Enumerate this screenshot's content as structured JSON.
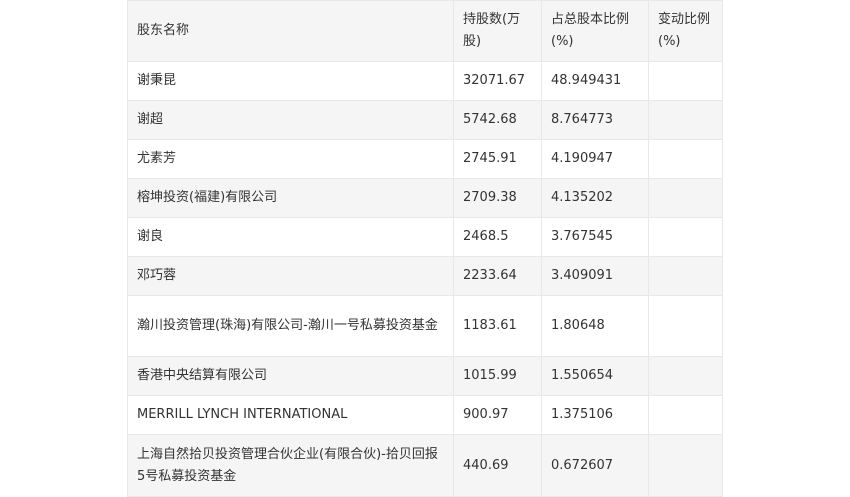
{
  "table": {
    "headers": [
      "股东名称",
      "持股数(万股)",
      "占总股本比例(%)",
      "变动比例(%)"
    ],
    "rows": [
      {
        "name": "谢秉昆",
        "shares": "32071.67",
        "ratio": "48.949431",
        "change": ""
      },
      {
        "name": "谢超",
        "shares": "5742.68",
        "ratio": "8.764773",
        "change": ""
      },
      {
        "name": "尤素芳",
        "shares": "2745.91",
        "ratio": "4.190947",
        "change": ""
      },
      {
        "name": "榕坤投资(福建)有限公司",
        "shares": "2709.38",
        "ratio": "4.135202",
        "change": ""
      },
      {
        "name": "谢良",
        "shares": "2468.5",
        "ratio": "3.767545",
        "change": ""
      },
      {
        "name": "邓巧蓉",
        "shares": "2233.64",
        "ratio": "3.409091",
        "change": ""
      },
      {
        "name": "瀚川投资管理(珠海)有限公司-瀚川一号私募投资基金",
        "shares": "1183.61",
        "ratio": "1.80648",
        "change": ""
      },
      {
        "name": "香港中央结算有限公司",
        "shares": "1015.99",
        "ratio": "1.550654",
        "change": ""
      },
      {
        "name": "MERRILL LYNCH INTERNATIONAL",
        "shares": "900.97",
        "ratio": "1.375106",
        "change": ""
      },
      {
        "name": "上海自然拾贝投资管理合伙企业(有限合伙)-拾贝回报5号私募投资基金",
        "shares": "440.69",
        "ratio": "0.672607",
        "change": ""
      }
    ]
  }
}
